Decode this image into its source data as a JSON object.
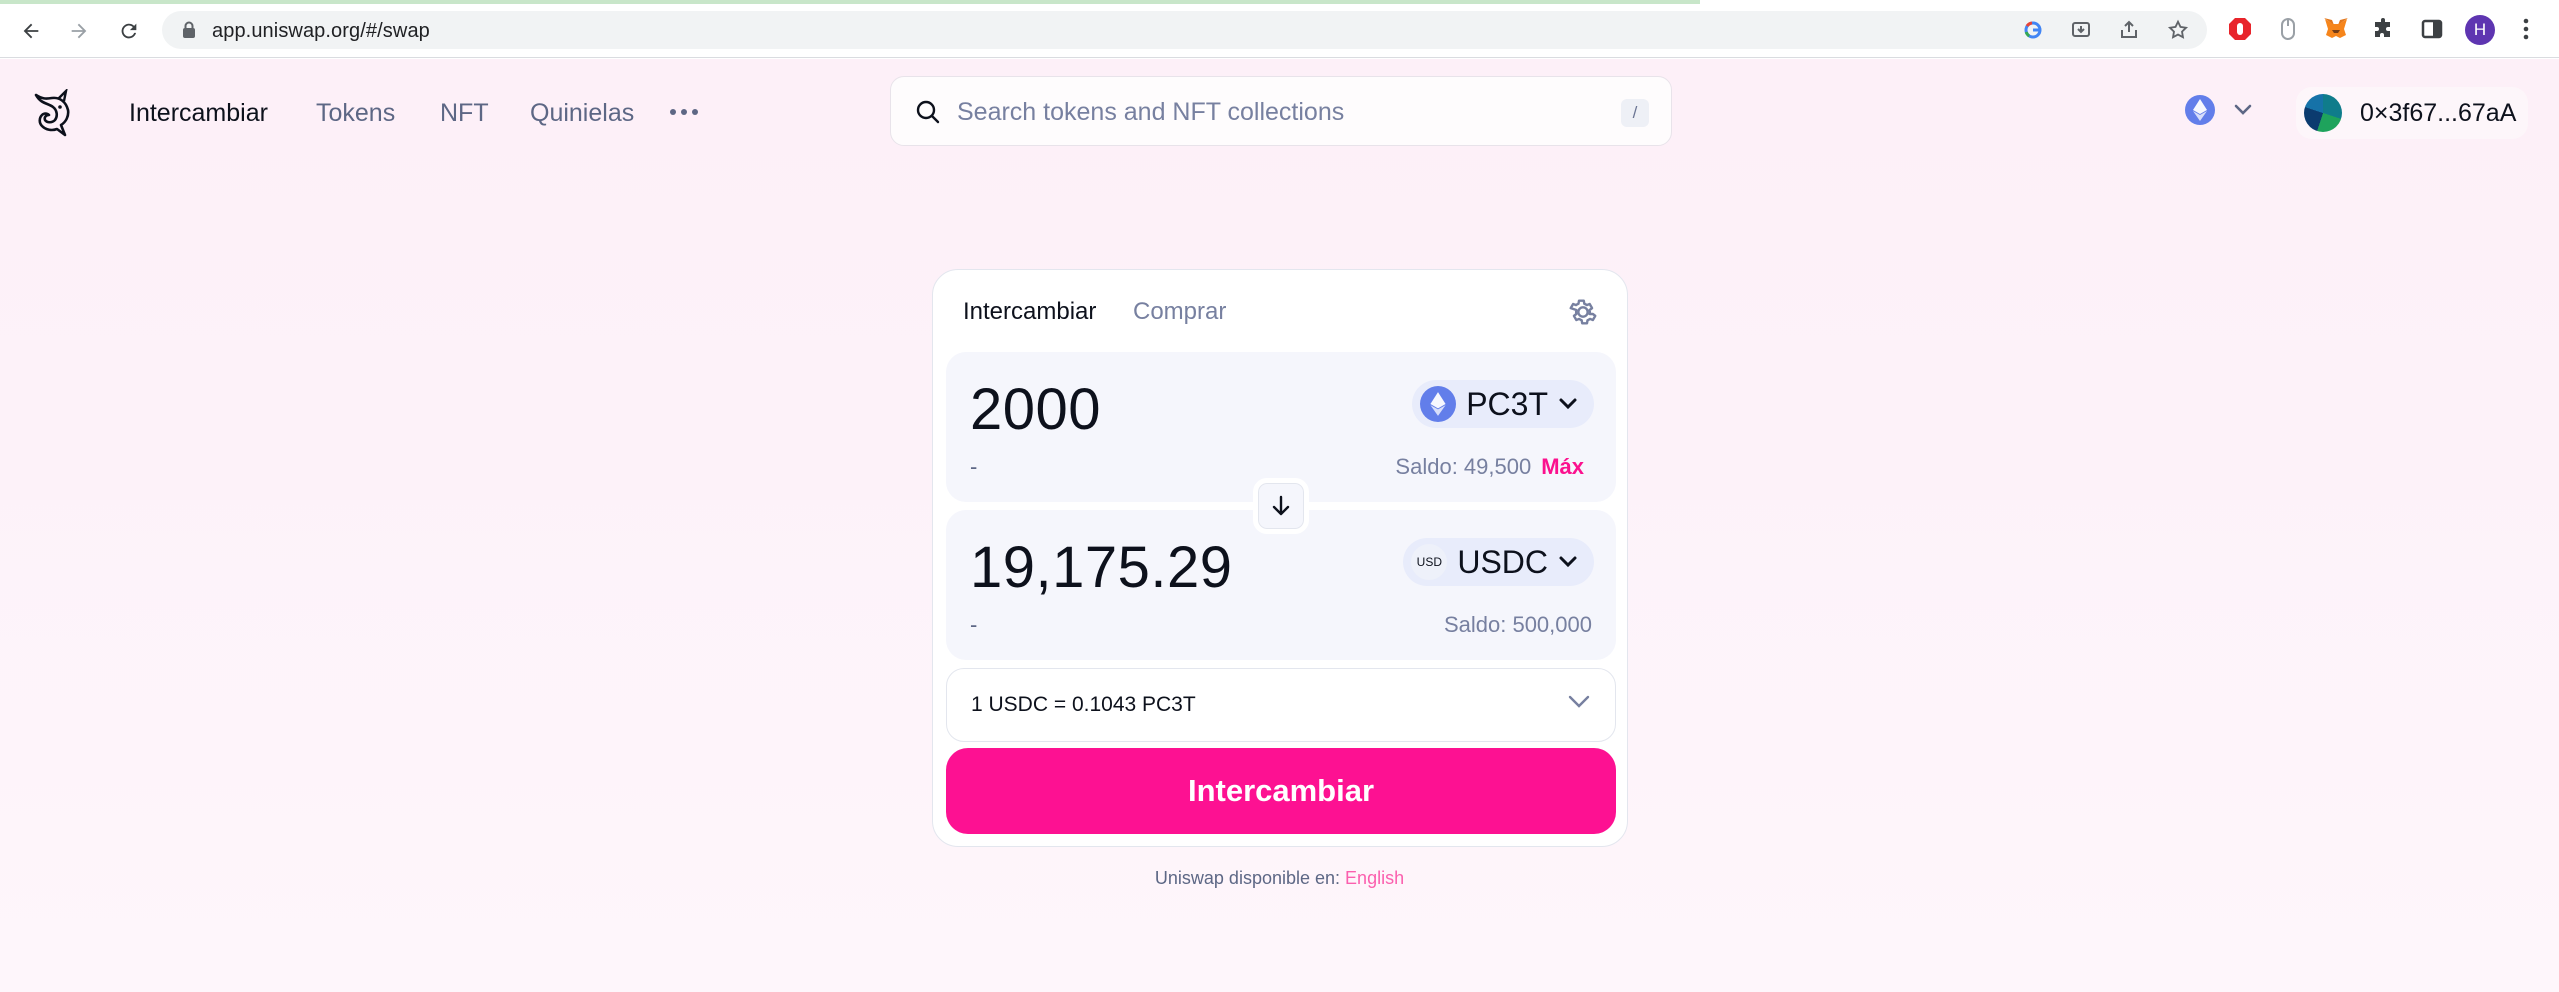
{
  "browser": {
    "url": "app.uniswap.org/#/swap",
    "profile_initial": "H"
  },
  "nav": {
    "items": [
      {
        "label": "Intercambiar",
        "active": true
      },
      {
        "label": "Tokens",
        "active": false
      },
      {
        "label": "NFT",
        "active": false
      },
      {
        "label": "Quinielas",
        "active": false
      }
    ]
  },
  "search": {
    "placeholder": "Search tokens and NFT collections",
    "shortcut": "/"
  },
  "wallet": {
    "address": "0×3f67...67aA"
  },
  "swap": {
    "tabs": [
      "Intercambiar",
      "Comprar"
    ],
    "input": {
      "amount": "2000",
      "usd_value": "-",
      "token": "PC3T",
      "balance": "Saldo: 49,500",
      "max_label": "Máx"
    },
    "output": {
      "amount": "19,175.29",
      "usd_value": "-",
      "token_tag": "USD",
      "token": "USDC",
      "balance": "Saldo: 500,000"
    },
    "rate": "1 USDC = 0.1043 PC3T",
    "button_label": "Intercambiar"
  },
  "footer": {
    "text": "Uniswap disponible en:",
    "language": "English"
  },
  "colors": {
    "accent": "#fd1192",
    "max_link": "#fb118e",
    "eth": "#627eea"
  }
}
